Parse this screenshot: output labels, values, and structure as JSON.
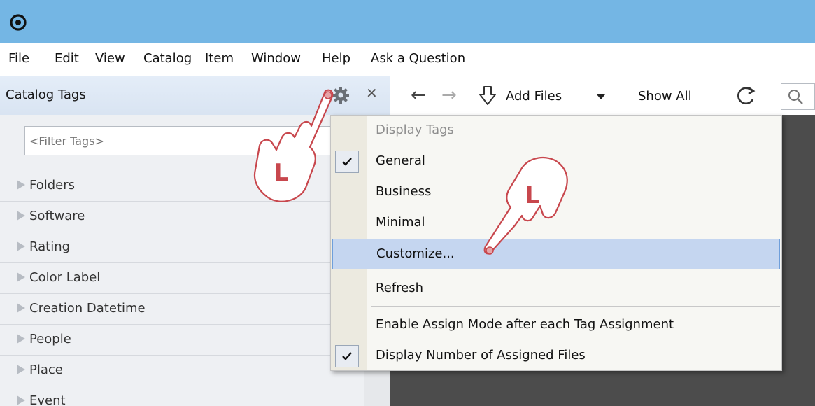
{
  "menubar": {
    "items": [
      "File",
      "Edit",
      "View",
      "Catalog",
      "Item",
      "Window",
      "Help",
      "Ask a Question"
    ]
  },
  "panel": {
    "title": "Catalog Tags",
    "close_glyph": "✕",
    "filter_placeholder": "<Filter Tags>",
    "tags": [
      "Folders",
      "Software",
      "Rating",
      "Color Label",
      "Creation Datetime",
      "People",
      "Place",
      "Event"
    ]
  },
  "toolbar": {
    "back_glyph": "←",
    "forward_glyph": "→",
    "add_files_label": "Add Files",
    "show_all_label": "Show All"
  },
  "popup_menu": {
    "header": "Display Tags",
    "general": "General",
    "business": "Business",
    "minimal": "Minimal",
    "customize": "Customize...",
    "refresh_first": "R",
    "refresh_rest": "efresh",
    "enable_assign": "Enable Assign Mode after each Tag Assignment",
    "display_number": "Display Number of Assigned Files"
  },
  "annotations": {
    "hand_letter_1": "L",
    "hand_letter_2": "L"
  },
  "icons": {
    "app": "app-logo-icon",
    "gear": "gear-icon",
    "close": "close-icon",
    "back": "arrow-left-icon",
    "forward": "arrow-right-icon",
    "add_files": "add-files-icon",
    "refresh": "refresh-icon",
    "search": "search-icon",
    "check": "check-icon",
    "expand": "triangle-right-icon"
  },
  "colors": {
    "titlebar": "#74b6e4",
    "highlight": "#c5d6f0",
    "highlight_border": "#6f9fdb",
    "content_dark": "#4c4c4c",
    "hand_stroke": "#c8474d"
  }
}
